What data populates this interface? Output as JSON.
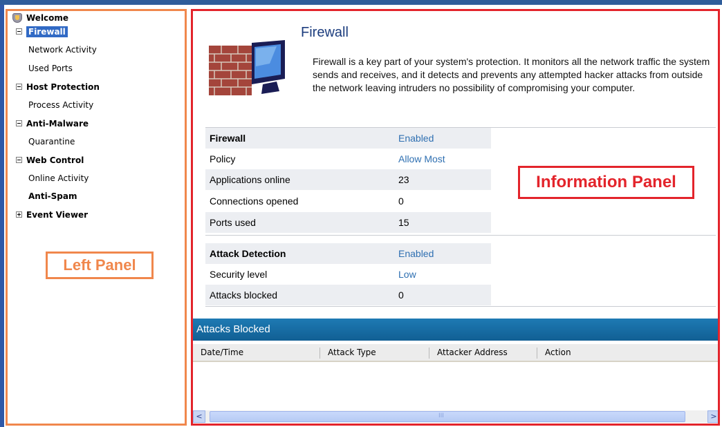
{
  "nav": {
    "welcome": "Welcome",
    "firewall": "Firewall",
    "network_activity": "Network Activity",
    "used_ports": "Used Ports",
    "host_protection": "Host Protection",
    "process_activity": "Process Activity",
    "anti_malware": "Anti-Malware",
    "quarantine": "Quarantine",
    "web_control": "Web Control",
    "online_activity": "Online Activity",
    "anti_spam": "Anti-Spam",
    "event_viewer": "Event Viewer"
  },
  "left_label": "Left Panel",
  "info_label": "Information Panel",
  "firewall": {
    "title": "Firewall",
    "description": "Firewall is a key part of your system's protection. It monitors all the network traffic the system sends and receives, and it detects and prevents any attempted hacker attacks from outside the network leaving intruders no possibility of compromising your computer."
  },
  "status": {
    "rows": [
      {
        "key": "Firewall",
        "value": "Enabled"
      },
      {
        "key": "Policy",
        "value": "Allow Most"
      },
      {
        "key": "Applications online",
        "value": "23"
      },
      {
        "key": "Connections opened",
        "value": "0"
      },
      {
        "key": "Ports used",
        "value": "15"
      }
    ],
    "attack_rows": [
      {
        "key": "Attack Detection",
        "value": "Enabled"
      },
      {
        "key": "Security level",
        "value": "Low"
      },
      {
        "key": "Attacks blocked",
        "value": "0"
      }
    ]
  },
  "attacks_blocked": {
    "title": "Attacks Blocked",
    "columns": [
      "Date/Time",
      "Attack Type",
      "Attacker Address",
      "Action"
    ]
  },
  "scrollbar": {
    "thumb_grip": "III",
    "left_arrow": "<",
    "right_arrow": ">"
  },
  "colors": {
    "left_outline": "#f0874c",
    "info_outline": "#e3242b",
    "selection": "#316ac5",
    "link": "#2e6fb1",
    "header_bar": "#1e7ab4"
  }
}
